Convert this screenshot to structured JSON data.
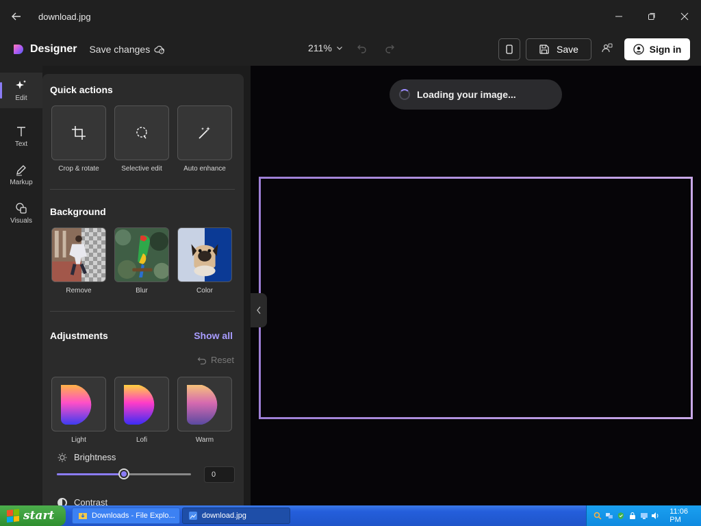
{
  "window": {
    "title": "download.jpg"
  },
  "toolbar": {
    "brand": "Designer",
    "save_changes": "Save changes",
    "zoom": "211%",
    "save_label": "Save",
    "signin_label": "Sign in"
  },
  "rail": {
    "items": [
      {
        "label": "Edit",
        "icon": "sparkle-icon"
      },
      {
        "label": "Text",
        "icon": "text-icon"
      },
      {
        "label": "Markup",
        "icon": "pen-icon"
      },
      {
        "label": "Visuals",
        "icon": "shapes-icon"
      }
    ]
  },
  "panel": {
    "quick_actions": {
      "title": "Quick actions",
      "items": [
        {
          "label": "Crop & rotate"
        },
        {
          "label": "Selective edit"
        },
        {
          "label": "Auto enhance"
        }
      ]
    },
    "background": {
      "title": "Background",
      "items": [
        {
          "label": "Remove"
        },
        {
          "label": "Blur"
        },
        {
          "label": "Color"
        }
      ]
    },
    "adjustments": {
      "title": "Adjustments",
      "show_all": "Show all",
      "reset": "Reset",
      "presets": [
        {
          "label": "Light"
        },
        {
          "label": "Lofi"
        },
        {
          "label": "Warm"
        }
      ],
      "brightness": {
        "label": "Brightness",
        "value": "0",
        "level": 0.5
      },
      "contrast": {
        "label": "Contrast"
      }
    }
  },
  "canvas": {
    "loading_text": "Loading your image..."
  },
  "taskbar": {
    "start": "start",
    "tasks": [
      {
        "label": "Downloads - File Explo..."
      },
      {
        "label": "download.jpg"
      }
    ],
    "clock": "11:06 PM"
  },
  "colors": {
    "accent": "#8b7cf6",
    "link": "#a89cff",
    "panel": "#2b2b2b"
  }
}
